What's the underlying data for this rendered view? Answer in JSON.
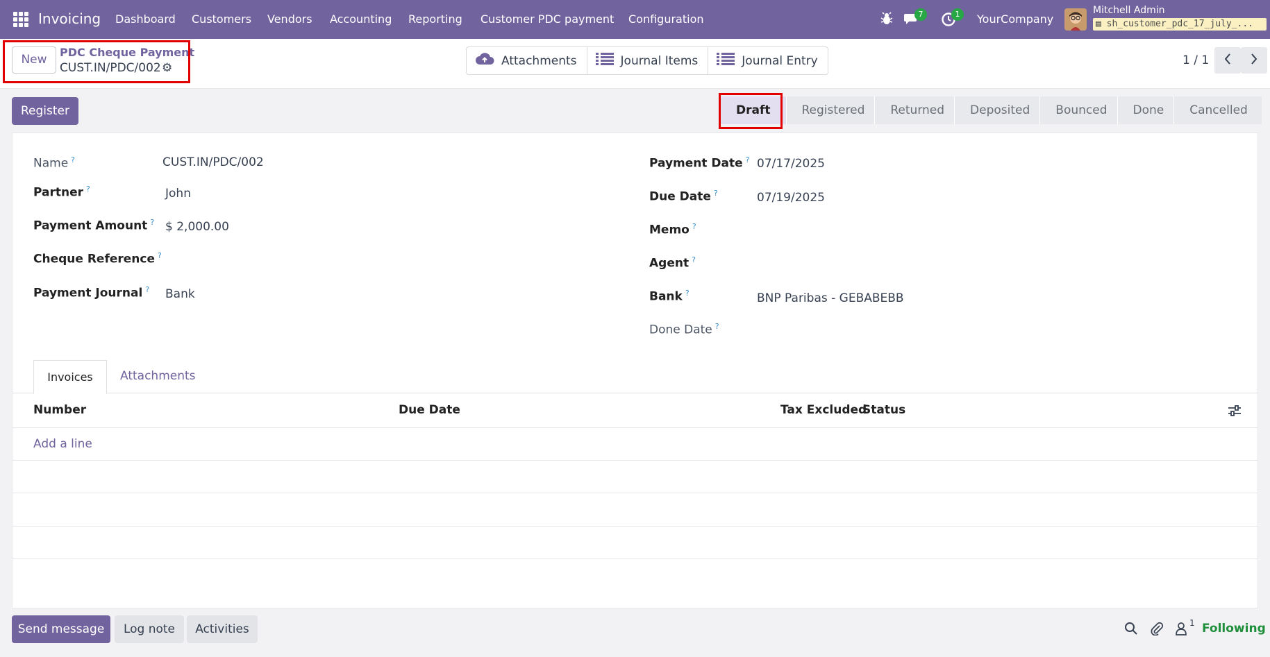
{
  "nav": {
    "app_title": "Invoicing",
    "menu": [
      "Dashboard",
      "Customers",
      "Vendors",
      "Accounting",
      "Reporting",
      "Customer PDC payment",
      "Configuration"
    ],
    "messages_count": "7",
    "activities_count": "1",
    "company": "YourCompany",
    "user_name": "Mitchell Admin",
    "db_name": "sh_customer_pdc_17_july_..."
  },
  "control": {
    "new_label": "New",
    "breadcrumb_parent": "PDC Cheque Payment",
    "breadcrumb_current": "CUST.IN/PDC/002",
    "actions": [
      "Attachments",
      "Journal Items",
      "Journal Entry"
    ],
    "pager": "1 / 1"
  },
  "status": {
    "register_label": "Register",
    "stages": [
      "Draft",
      "Registered",
      "Returned",
      "Deposited",
      "Bounced",
      "Done",
      "Cancelled"
    ],
    "active_stage": "Draft"
  },
  "form": {
    "left": [
      {
        "label": "Name",
        "value": "CUST.IN/PDC/002"
      },
      {
        "label": "Partner",
        "value": "John"
      },
      {
        "label": "Payment Amount",
        "value": "$ 2,000.00"
      },
      {
        "label": "Cheque Reference",
        "value": ""
      },
      {
        "label": "Payment Journal",
        "value": "Bank"
      }
    ],
    "right": [
      {
        "label": "Payment Date",
        "value": "07/17/2025"
      },
      {
        "label": "Due Date",
        "value": "07/19/2025"
      },
      {
        "label": "Memo",
        "value": ""
      },
      {
        "label": "Agent",
        "value": ""
      },
      {
        "label": "Bank",
        "value": "BNP Paribas - GEBABEBB"
      },
      {
        "label": "Done Date",
        "value": ""
      }
    ],
    "help_mark": "?"
  },
  "tabs": [
    "Invoices",
    "Attachments"
  ],
  "table": {
    "columns": [
      "Number",
      "Due Date",
      "Tax Excluded",
      "Status"
    ],
    "add_line": "Add a line"
  },
  "chatter": {
    "send_message": "Send message",
    "log_note": "Log note",
    "activities": "Activities",
    "followers_count": "1",
    "following": "Following"
  },
  "colors": {
    "brand": "#71639e",
    "highlight_box": "#e00000",
    "badge": "#28a745"
  }
}
